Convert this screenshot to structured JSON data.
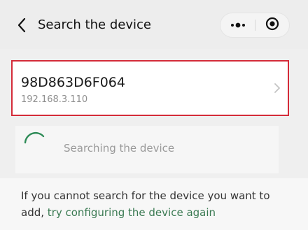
{
  "header": {
    "back_icon": "chevron-left-icon",
    "title": "Search the device",
    "menu_icon": "more-dots-icon",
    "close_icon": "target-circle-icon"
  },
  "device": {
    "name": "98D863D6F064",
    "ip": "192.168.3.110",
    "chevron_icon": "chevron-right-icon",
    "highlight_color": "#d42b39"
  },
  "search_status": {
    "spinner_icon": "loading-spinner-icon",
    "text": "Searching the device",
    "spinner_color": "#2e8b57"
  },
  "help": {
    "text": "If you cannot search for the device you want to add,",
    "link_text": "try configuring the device again",
    "link_color": "#3a7a52"
  }
}
